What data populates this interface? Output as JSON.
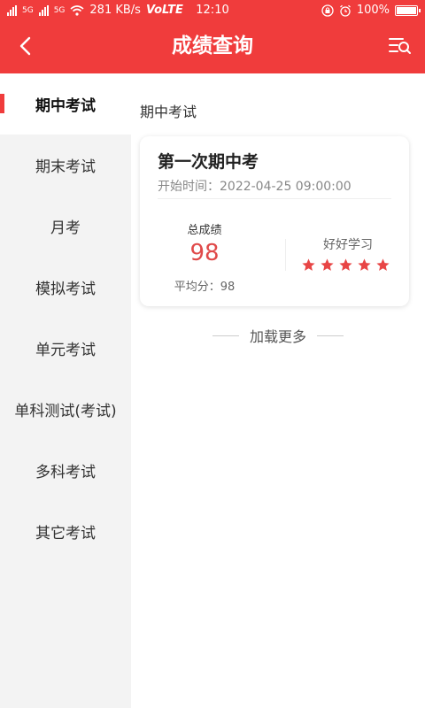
{
  "status_bar": {
    "signal1": "5G",
    "signal2": "5G",
    "speed": "281 KB/s",
    "volte": "VoLTE",
    "time": "12:10",
    "battery": "100%"
  },
  "header": {
    "title": "成绩查询",
    "back_icon": "chevron-left-icon",
    "filter_icon": "list-search-icon",
    "color": "#f03c3c"
  },
  "sidebar": {
    "active_index": 0,
    "items": [
      {
        "label": "期中考试"
      },
      {
        "label": "期末考试"
      },
      {
        "label": "月考"
      },
      {
        "label": "模拟考试"
      },
      {
        "label": "单元考试"
      },
      {
        "label": "单科测试(考试)"
      },
      {
        "label": "多科考试"
      },
      {
        "label": "其它考试"
      }
    ]
  },
  "main": {
    "section_label": "期中考试",
    "cards": [
      {
        "title": "第一次期中考",
        "start_time": "开始时间：2022-04-25 09:00:00",
        "score_label": "总成绩",
        "score": "98",
        "average": "平均分：98",
        "comment": "好好学习",
        "stars": 5
      }
    ],
    "load_more": "加载更多"
  }
}
